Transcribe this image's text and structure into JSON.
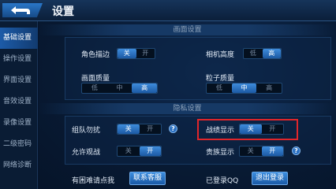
{
  "header": {
    "title": "设置"
  },
  "sidebar": {
    "items": [
      {
        "label": "基础设置",
        "active": true
      },
      {
        "label": "操作设置",
        "active": false
      },
      {
        "label": "界面设置",
        "active": false
      },
      {
        "label": "音效设置",
        "active": false
      },
      {
        "label": "录像设置",
        "active": false
      },
      {
        "label": "二级密码",
        "active": false
      },
      {
        "label": "网络诊断",
        "active": false
      }
    ]
  },
  "picture_settings": {
    "section_title": "画面设置",
    "outline": {
      "label": "角色描边",
      "options": [
        "关",
        "开"
      ],
      "selected": "关"
    },
    "frame_rate": {
      "label": "相机高度",
      "options": [
        "低",
        "高"
      ],
      "selected": "高"
    },
    "quality": {
      "label": "画面质量",
      "options": [
        "低",
        "中",
        "高"
      ],
      "selected": "高"
    },
    "particles": {
      "label": "粒子质量",
      "options": [
        "低",
        "中",
        "高"
      ],
      "selected": "中"
    }
  },
  "privacy_settings": {
    "section_title": "隐私设置",
    "team_disturb": {
      "label": "组队勿扰",
      "options": [
        "关",
        "开"
      ],
      "selected": "关",
      "help": "?"
    },
    "record_display": {
      "label": "战绩显示",
      "options": [
        "关",
        "开"
      ],
      "selected": "关"
    },
    "allow_spectate": {
      "label": "允许观战",
      "options": [
        "关",
        "开"
      ],
      "selected": "开"
    },
    "nobility_display": {
      "label": "贵族显示",
      "options": [
        "关",
        "开"
      ],
      "selected": "开",
      "help": "?"
    }
  },
  "footer": {
    "help_label": "有困难请点我",
    "contact_button": "联系客服",
    "login_status": "已登录QQ",
    "logout_button": "退出登录"
  },
  "colors": {
    "accent": "#2a77c9",
    "highlight": "#e0262b"
  }
}
